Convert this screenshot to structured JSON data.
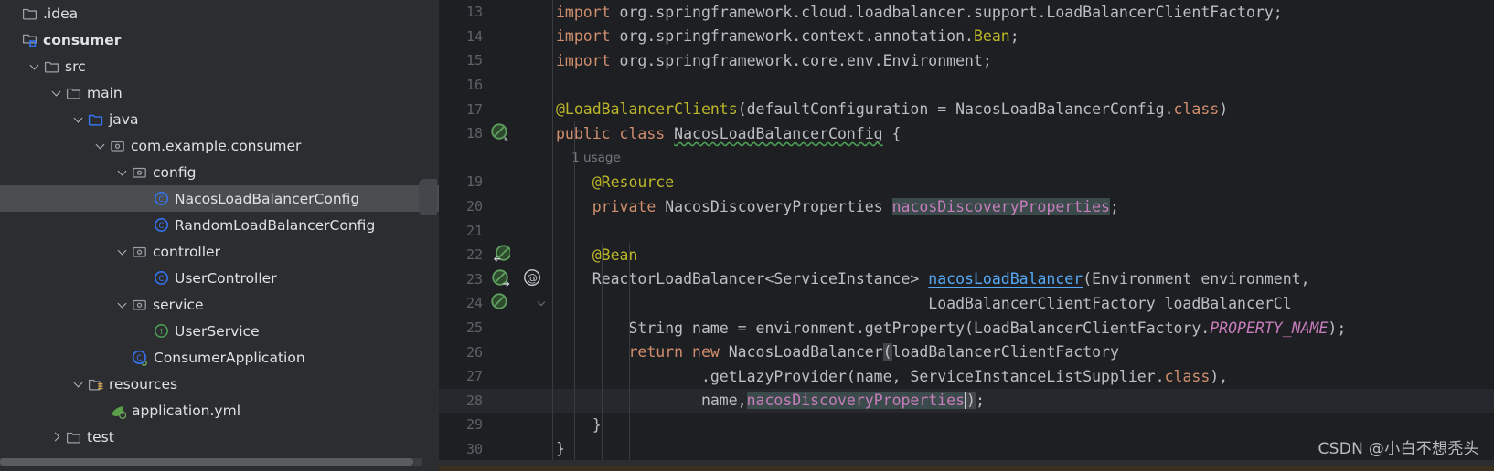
{
  "window": {
    "watermark": "CSDN @小白不想秃头"
  },
  "project_tree": {
    "name": "project-tree",
    "items": [
      {
        "label": ".idea",
        "indent": 0,
        "arrow": "none",
        "icon": "folder-hidden-icon",
        "selected": false,
        "bold": false
      },
      {
        "label": "consumer",
        "indent": 0,
        "arrow": "none",
        "icon": "module-icon",
        "selected": false,
        "bold": true
      },
      {
        "label": "src",
        "indent": 1,
        "arrow": "down",
        "icon": "folder-icon",
        "selected": false,
        "bold": false
      },
      {
        "label": "main",
        "indent": 2,
        "arrow": "down",
        "icon": "folder-icon",
        "selected": false,
        "bold": false
      },
      {
        "label": "java",
        "indent": 3,
        "arrow": "down",
        "icon": "source-root-icon",
        "selected": false,
        "bold": false
      },
      {
        "label": "com.example.consumer",
        "indent": 4,
        "arrow": "down",
        "icon": "package-icon",
        "selected": false,
        "bold": false
      },
      {
        "label": "config",
        "indent": 5,
        "arrow": "down",
        "icon": "package-icon",
        "selected": false,
        "bold": false
      },
      {
        "label": "NacosLoadBalancerConfig",
        "indent": 6,
        "arrow": "none",
        "icon": "java-class-icon",
        "selected": true,
        "bold": false
      },
      {
        "label": "RandomLoadBalancerConfig",
        "indent": 6,
        "arrow": "none",
        "icon": "java-class-icon",
        "selected": false,
        "bold": false
      },
      {
        "label": "controller",
        "indent": 5,
        "arrow": "down",
        "icon": "package-icon",
        "selected": false,
        "bold": false
      },
      {
        "label": "UserController",
        "indent": 6,
        "arrow": "none",
        "icon": "java-class-icon",
        "selected": false,
        "bold": false
      },
      {
        "label": "service",
        "indent": 5,
        "arrow": "down",
        "icon": "package-icon",
        "selected": false,
        "bold": false
      },
      {
        "label": "UserService",
        "indent": 6,
        "arrow": "none",
        "icon": "java-interface-icon",
        "selected": false,
        "bold": false
      },
      {
        "label": "ConsumerApplication",
        "indent": 5,
        "arrow": "none",
        "icon": "spring-class-icon",
        "selected": false,
        "bold": false
      },
      {
        "label": "resources",
        "indent": 3,
        "arrow": "down",
        "icon": "resource-root-icon",
        "selected": false,
        "bold": false
      },
      {
        "label": "application.yml",
        "indent": 4,
        "arrow": "none",
        "icon": "spring-yaml-icon",
        "selected": false,
        "bold": false
      },
      {
        "label": "test",
        "indent": 2,
        "arrow": "right",
        "icon": "folder-icon",
        "selected": false,
        "bold": false
      }
    ]
  },
  "editor": {
    "name": "code-editor",
    "language": "java",
    "file": "NacosLoadBalancerConfig",
    "current_line": 28,
    "lines": [
      {
        "num": "13",
        "gutter": "",
        "gutter2": "",
        "fold": false,
        "current": false,
        "tokens": [
          {
            "t": "import ",
            "c": "k"
          },
          {
            "t": "org.springframework.cloud.loadbalancer.support.LoadBalancerClientFactory;",
            "c": "s"
          }
        ]
      },
      {
        "num": "14",
        "gutter": "",
        "gutter2": "",
        "fold": false,
        "current": false,
        "tokens": [
          {
            "t": "import ",
            "c": "k"
          },
          {
            "t": "org.springframework.context.annotation.",
            "c": "s"
          },
          {
            "t": "Bean",
            "c": "an"
          },
          {
            "t": ";",
            "c": "s"
          }
        ]
      },
      {
        "num": "15",
        "gutter": "",
        "gutter2": "",
        "fold": false,
        "current": false,
        "tokens": [
          {
            "t": "import ",
            "c": "k"
          },
          {
            "t": "org.springframework.core.env.Environment;",
            "c": "s"
          }
        ]
      },
      {
        "num": "16",
        "gutter": "",
        "gutter2": "",
        "fold": false,
        "current": false,
        "tokens": []
      },
      {
        "num": "17",
        "gutter": "",
        "gutter2": "",
        "fold": false,
        "current": false,
        "tokens": [
          {
            "t": "@LoadBalancerClients",
            "c": "an"
          },
          {
            "t": "(defaultConfiguration = NacosLoadBalancerConfig.",
            "c": "s"
          },
          {
            "t": "class",
            "c": "k"
          },
          {
            "t": ")",
            "c": "s"
          }
        ]
      },
      {
        "num": "18",
        "gutter": "bean-icon",
        "gutter2": "",
        "fold": false,
        "current": false,
        "tokens": [
          {
            "t": "public class ",
            "c": "k"
          },
          {
            "t": "NacosLoadBalancerConfig",
            "c": "s wavy"
          },
          {
            "t": " {",
            "c": "s"
          }
        ]
      },
      {
        "num": "",
        "gutter": "",
        "gutter2": "",
        "fold": false,
        "current": false,
        "tokens": [
          {
            "t": "    1 usage",
            "c": "hint"
          }
        ]
      },
      {
        "num": "19",
        "gutter": "",
        "gutter2": "",
        "fold": false,
        "current": false,
        "tokens": [
          {
            "t": "    @Resource",
            "c": "an"
          }
        ]
      },
      {
        "num": "20",
        "gutter": "",
        "gutter2": "",
        "fold": false,
        "current": false,
        "tokens": [
          {
            "t": "    private ",
            "c": "k"
          },
          {
            "t": "NacosDiscoveryProperties ",
            "c": "s"
          },
          {
            "t": "nacosDiscoveryProperties",
            "c": "fld hl"
          },
          {
            "t": ";",
            "c": "s"
          }
        ]
      },
      {
        "num": "21",
        "gutter": "",
        "gutter2": "",
        "fold": false,
        "current": false,
        "tokens": []
      },
      {
        "num": "22",
        "gutter": "bean-override-icon",
        "gutter2": "",
        "fold": false,
        "current": false,
        "tokens": [
          {
            "t": "    @Bean",
            "c": "an"
          }
        ]
      },
      {
        "num": "23",
        "gutter": "bean-implement-icon",
        "gutter2": "at-icon",
        "fold": false,
        "current": false,
        "tokens": [
          {
            "t": "    ReactorLoadBalancer<ServiceInstance> ",
            "c": "s"
          },
          {
            "t": "nacosLoadBalancer",
            "c": "m und wavy"
          },
          {
            "t": "(Environment environment,",
            "c": "s"
          }
        ]
      },
      {
        "num": "24",
        "gutter": "bean-icon2",
        "gutter2": "",
        "fold": true,
        "current": false,
        "tokens": [
          {
            "t": "                                         LoadBalancerClientFactory loadBalancerCl",
            "c": "s"
          }
        ]
      },
      {
        "num": "25",
        "gutter": "",
        "gutter2": "",
        "fold": false,
        "current": false,
        "tokens": [
          {
            "t": "        String name = environment.getProperty(LoadBalancerClientFactory.",
            "c": "s"
          },
          {
            "t": "PROPERTY_NAME",
            "c": "cn"
          },
          {
            "t": ");",
            "c": "s"
          }
        ]
      },
      {
        "num": "26",
        "gutter": "",
        "gutter2": "",
        "fold": false,
        "current": false,
        "tokens": [
          {
            "t": "        return new ",
            "c": "k"
          },
          {
            "t": "NacosLoadBalancer",
            "c": "s"
          },
          {
            "t": "(",
            "c": "s sel"
          },
          {
            "t": "loadBalancerClientFactory",
            "c": "s"
          }
        ]
      },
      {
        "num": "27",
        "gutter": "",
        "gutter2": "",
        "fold": false,
        "current": false,
        "tokens": [
          {
            "t": "                .getLazyProvider(name, ServiceInstanceListSupplier.",
            "c": "s"
          },
          {
            "t": "class",
            "c": "k"
          },
          {
            "t": "),",
            "c": "s"
          }
        ]
      },
      {
        "num": "28",
        "gutter": "",
        "gutter2": "",
        "fold": false,
        "current": true,
        "tokens": [
          {
            "t": "                name,",
            "c": "s"
          },
          {
            "t": "nacosDiscoveryProperties",
            "c": "fld hl"
          },
          {
            "t": ")",
            "c": "s sel"
          },
          {
            "t": ";",
            "c": "s"
          }
        ]
      },
      {
        "num": "29",
        "gutter": "",
        "gutter2": "",
        "fold": false,
        "current": false,
        "tokens": [
          {
            "t": "    }",
            "c": "s"
          }
        ]
      },
      {
        "num": "30",
        "gutter": "",
        "gutter2": "",
        "fold": false,
        "current": false,
        "tokens": [
          {
            "t": "}",
            "c": "s"
          }
        ]
      }
    ]
  },
  "colors": {
    "tree_bg": "#2b2d30",
    "editor_bg": "#1e1f22",
    "selection_bg": "#4b4e51",
    "current_line_bg": "#26282e",
    "keyword": "#cf8e6d",
    "annotation": "#bbb529",
    "field": "#c77dbb",
    "method": "#56a8f5",
    "text": "#bcbec4",
    "line_number": "#5d6166"
  }
}
